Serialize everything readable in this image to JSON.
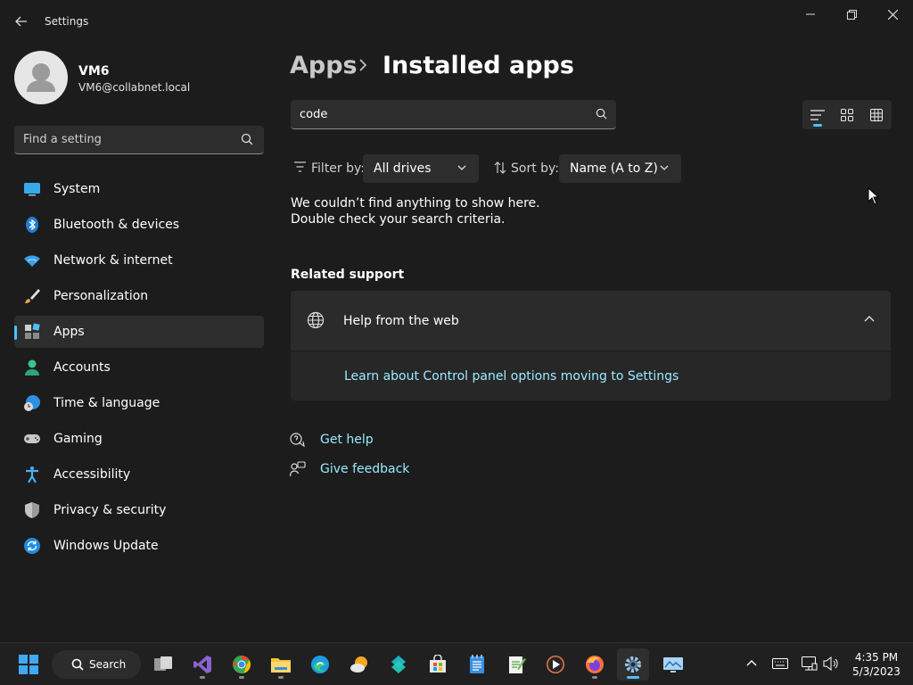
{
  "window": {
    "title": "Settings"
  },
  "user": {
    "name": "VM6",
    "email": "VM6@collabnet.local"
  },
  "sidebar": {
    "search_placeholder": "Find a setting",
    "items": [
      {
        "label": "System",
        "icon": "system-icon"
      },
      {
        "label": "Bluetooth & devices",
        "icon": "bluetooth-icon"
      },
      {
        "label": "Network & internet",
        "icon": "wifi-icon"
      },
      {
        "label": "Personalization",
        "icon": "brush-icon"
      },
      {
        "label": "Apps",
        "icon": "apps-icon",
        "selected": true
      },
      {
        "label": "Accounts",
        "icon": "person-icon"
      },
      {
        "label": "Time & language",
        "icon": "clock-globe-icon"
      },
      {
        "label": "Gaming",
        "icon": "gamepad-icon"
      },
      {
        "label": "Accessibility",
        "icon": "accessibility-icon"
      },
      {
        "label": "Privacy & security",
        "icon": "shield-icon"
      },
      {
        "label": "Windows Update",
        "icon": "update-icon"
      }
    ]
  },
  "main": {
    "breadcrumb": {
      "parent": "Apps",
      "current": "Installed apps"
    },
    "search_value": "code",
    "filter": {
      "label": "Filter by:",
      "value": "All drives"
    },
    "sort": {
      "label": "Sort by:",
      "value": "Name (A to Z)"
    },
    "empty_message": "We couldn’t find anything to show here. Double check your search criteria.",
    "related": {
      "title": "Related support",
      "card_title": "Help from the web",
      "link": "Learn about Control panel options moving to Settings"
    },
    "get_help": "Get help",
    "give_feedback": "Give feedback"
  },
  "taskbar": {
    "search_label": "Search",
    "time": "4:35 PM",
    "date": "5/3/2023",
    "apps": [
      "start-icon",
      "task-view-icon",
      "visual-studio-icon",
      "chrome-icon",
      "file-explorer-icon",
      "edge-icon",
      "weather-icon",
      "code-app-icon",
      "store-icon",
      "notepad-icon",
      "notepadpp-icon",
      "media-player-icon",
      "firefox-icon",
      "settings-icon",
      "remote-desktop-icon"
    ]
  },
  "colors": {
    "accent": "#4cc2ff",
    "link": "#99ebff",
    "background": "#1c1c1c"
  }
}
